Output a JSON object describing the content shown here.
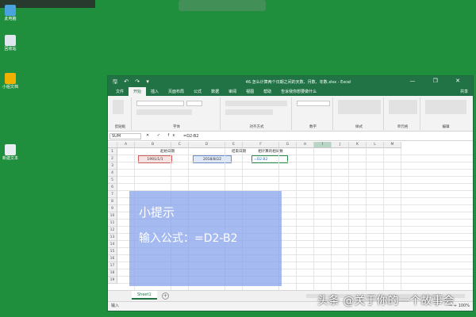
{
  "desktop": {
    "icons": [
      {
        "label": "此电脑",
        "color": "#4aa3df"
      },
      {
        "label": "回收站",
        "color": "#dfe6ee"
      },
      {
        "label": "小姐文档",
        "color": "#f0b000"
      },
      {
        "label": "新建文本",
        "color": "#e9eef2"
      }
    ]
  },
  "window": {
    "title": "46.怎么计算两个日期之间的天数、月数、年数.xlsx - Excel",
    "qat": "🖫 ↶ ↷ ▾",
    "controls": "—  ❐  ✕",
    "tabs": [
      "文件",
      "开始",
      "插入",
      "页面布局",
      "公式",
      "数据",
      "审阅",
      "视图",
      "帮助",
      "告诉我你想要做什么"
    ],
    "active_tab": "开始",
    "share": "共享",
    "ribbon_groups": [
      "剪贴板",
      "字体",
      "对齐方式",
      "数字",
      "样式",
      "单元格",
      "编辑"
    ]
  },
  "formula_bar": {
    "name_box": "SUM",
    "fx_icons": "✕ ✓ fx",
    "formula": "=D2-B2"
  },
  "grid": {
    "columns": [
      "A",
      "B",
      "C",
      "D",
      "E",
      "F",
      "G",
      "H",
      "I",
      "J",
      "K",
      "L",
      "M"
    ],
    "selected_column": "I",
    "rows": [
      "1",
      "2",
      "3",
      "4",
      "5",
      "6",
      "7",
      "8",
      "9",
      "10",
      "11",
      "12",
      "13",
      "14",
      "15",
      "16",
      "17",
      "18",
      "19"
    ],
    "cells": {
      "b1": "起始日期",
      "d1": "结束日期",
      "f1": "相计算的相间数",
      "b2": "1991/1/1",
      "d2": "2018/8/22",
      "f2": "=D2-B2"
    }
  },
  "tip": {
    "title": "小提示",
    "body": "输入公式：=D2-B2"
  },
  "sheet_tab": "Sheet1",
  "add_sheet": "+",
  "status": {
    "mode": "输入",
    "right": "— + 100%"
  },
  "watermark": "头条 @关于你的一个故事会"
}
